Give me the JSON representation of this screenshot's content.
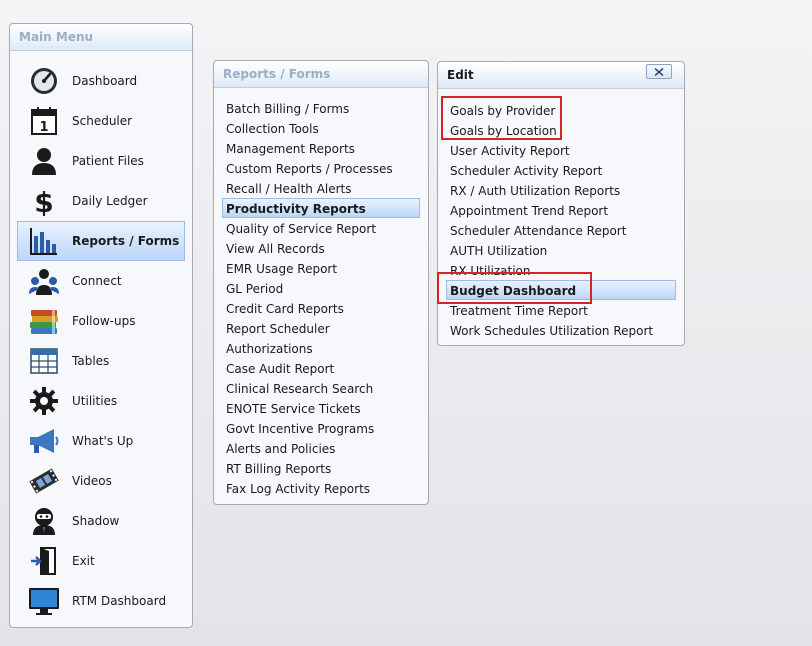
{
  "main_menu": {
    "title": "Main Menu",
    "items": [
      {
        "label": "Dashboard",
        "icon": "dashboard-gauge-icon"
      },
      {
        "label": "Scheduler",
        "icon": "calendar-icon"
      },
      {
        "label": "Patient Files",
        "icon": "person-icon"
      },
      {
        "label": "Daily Ledger",
        "icon": "dollar-icon"
      },
      {
        "label": "Reports / Forms",
        "icon": "bar-chart-icon"
      },
      {
        "label": "Connect",
        "icon": "people-group-icon"
      },
      {
        "label": "Follow-ups",
        "icon": "books-icon"
      },
      {
        "label": "Tables",
        "icon": "table-grid-icon"
      },
      {
        "label": "Utilities",
        "icon": "gear-icon"
      },
      {
        "label": "What's Up",
        "icon": "megaphone-icon"
      },
      {
        "label": "Videos",
        "icon": "film-icon"
      },
      {
        "label": "Shadow",
        "icon": "ninja-icon"
      },
      {
        "label": "Exit",
        "icon": "exit-door-icon"
      },
      {
        "label": "RTM Dashboard",
        "icon": "monitor-icon"
      }
    ],
    "selected": "Reports / Forms"
  },
  "reports_forms": {
    "title": "Reports / Forms",
    "items": [
      "Batch Billing / Forms",
      "Collection Tools",
      "Management Reports",
      "Custom Reports / Processes",
      "Recall / Health Alerts",
      "Productivity Reports",
      "Quality of Service Report",
      "View All Records",
      "EMR Usage Report",
      "GL Period",
      "Credit Card Reports",
      "Report Scheduler",
      "Authorizations",
      "Case Audit Report",
      "Clinical Research Search",
      "ENOTE Service Tickets",
      "Govt Incentive Programs",
      "Alerts and Policies",
      "RT Billing Reports",
      "Fax Log Activity Reports"
    ],
    "selected": "Productivity Reports"
  },
  "edit_menu": {
    "title": "Edit",
    "close_icon": "close-x-icon",
    "items": [
      "Goals by Provider",
      "Goals by Location",
      "User Activity Report",
      "Scheduler Activity Report",
      "RX / Auth Utilization Reports",
      "Appointment Trend Report",
      "Scheduler Attendance Report",
      "AUTH Utilization",
      "RX Utilization",
      "Budget Dashboard",
      "Treatment Time Report",
      "Work Schedules Utilization Report"
    ],
    "selected": "Budget Dashboard"
  },
  "colors": {
    "highlight_red": "#d6232a",
    "selection_blue": "#cfe2fb",
    "muted_title": "#9aaec5"
  }
}
